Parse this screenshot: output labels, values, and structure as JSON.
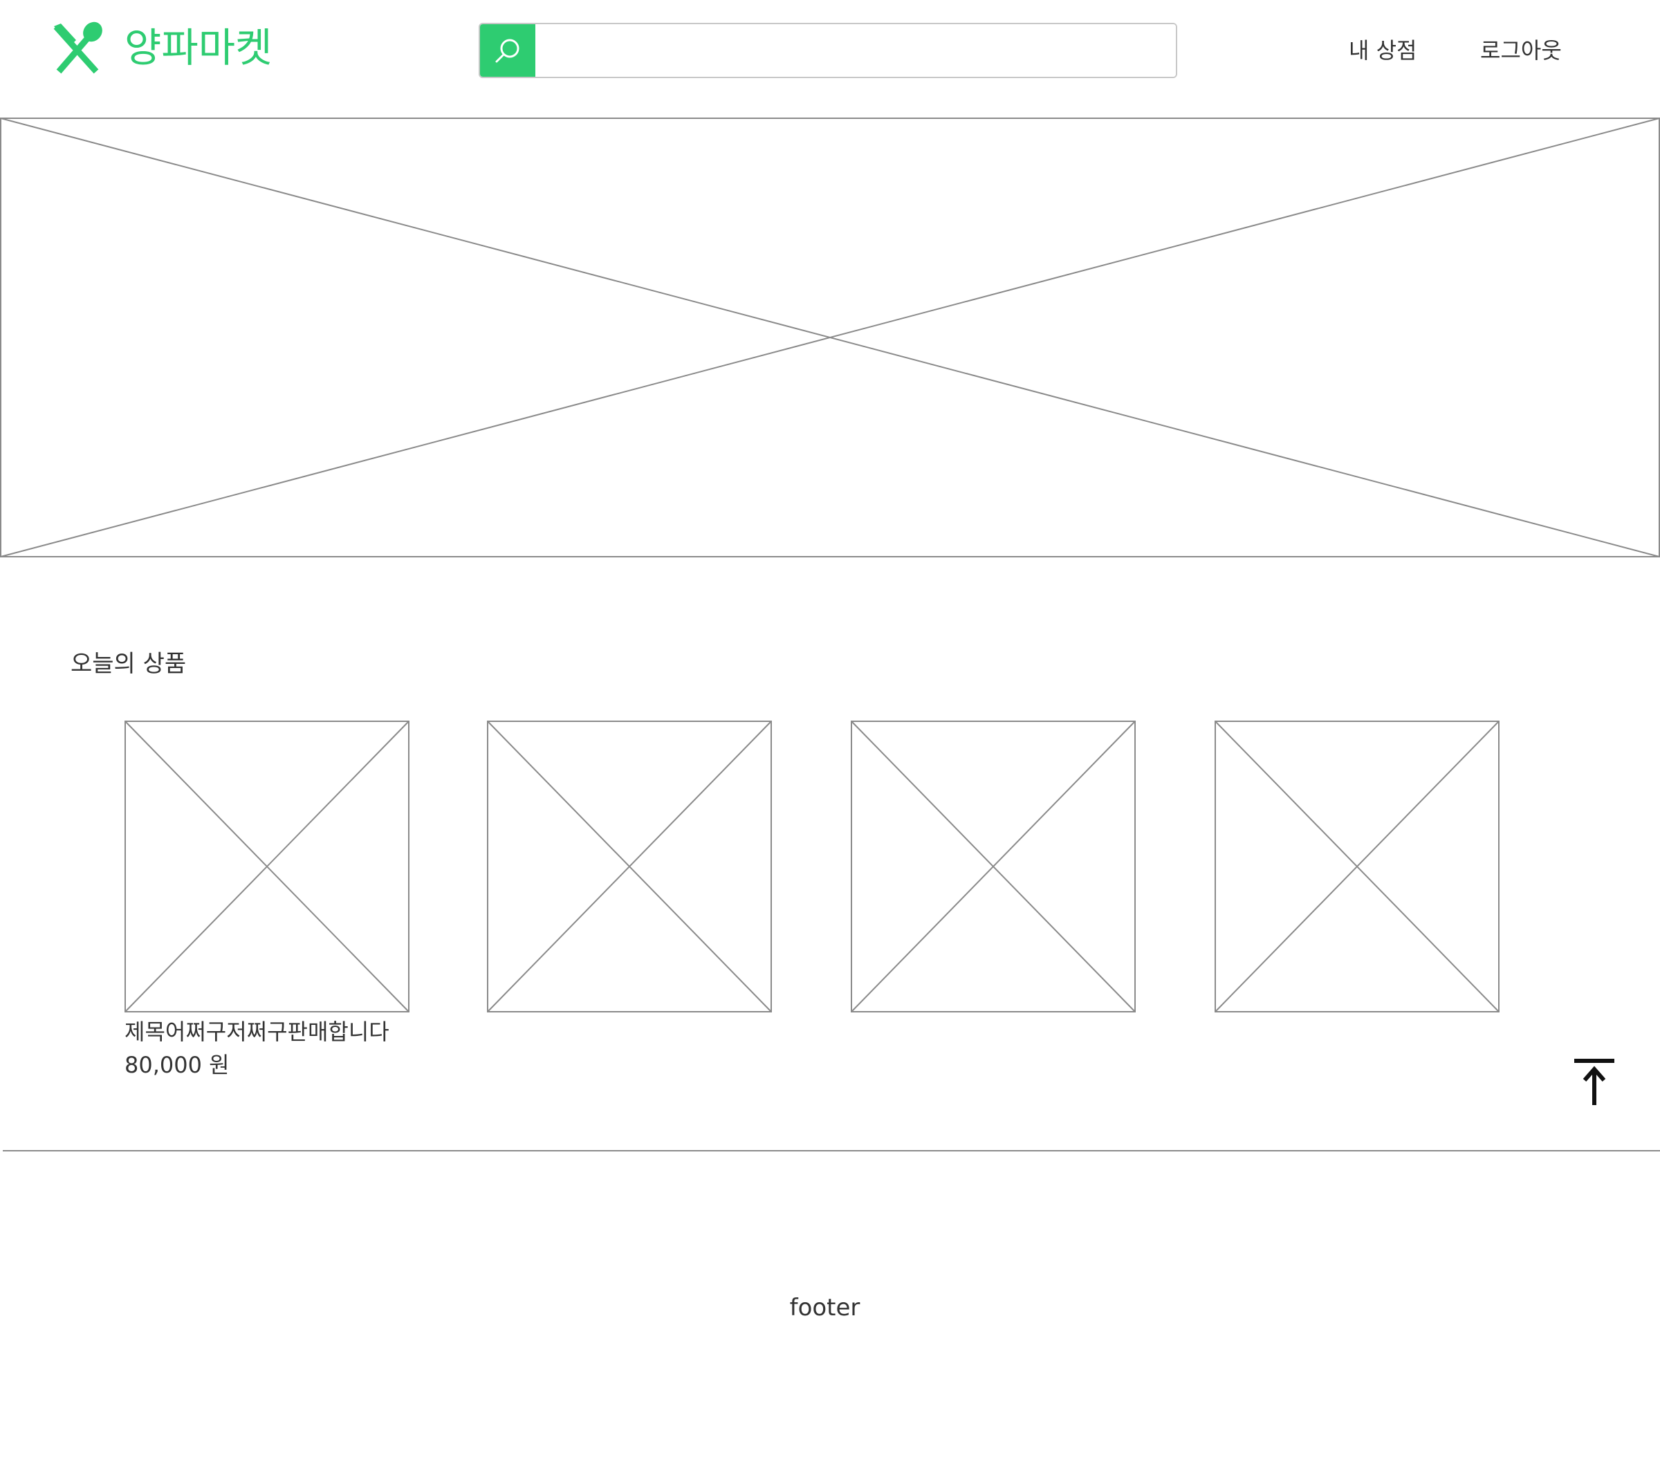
{
  "header": {
    "logo_text": "양파마켓",
    "search": {
      "placeholder": "",
      "value": ""
    },
    "nav": {
      "my_store": "내 상점",
      "logout": "로그아웃"
    }
  },
  "main": {
    "section_title": "오늘의 상품",
    "products": [
      {
        "name": "제목어쩌구저쩌구판매합니다",
        "price": "80,000 원"
      },
      {
        "name": "",
        "price": ""
      },
      {
        "name": "",
        "price": ""
      },
      {
        "name": "",
        "price": ""
      }
    ]
  },
  "footer": {
    "text": "footer"
  },
  "colors": {
    "brand": "#2ecc71",
    "placeholder_stroke": "#8a8a8a",
    "text": "#333333"
  },
  "icons": {
    "logo": "spoon-knife-icon",
    "search": "search-icon",
    "top": "scroll-top-icon"
  }
}
